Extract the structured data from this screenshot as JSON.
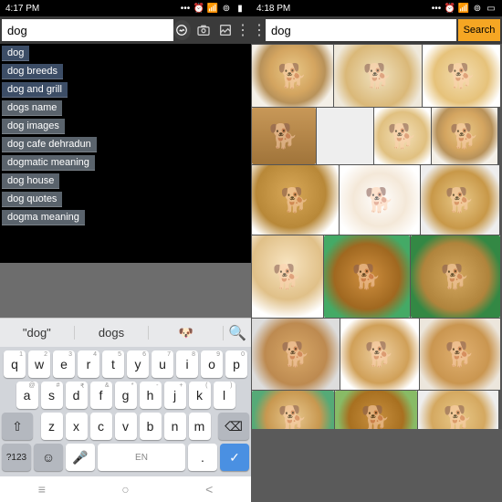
{
  "left": {
    "status": {
      "time": "4:17 PM",
      "icons": [
        "alarm",
        "wifi",
        "signal",
        "signal",
        "battery"
      ]
    },
    "search": {
      "value": "dog"
    },
    "suggestions": [
      "dog",
      "dog breeds",
      "dog and grill",
      "dogs name",
      "dog images",
      "dog cafe dehradun",
      "dogmatic meaning",
      "dog house",
      "dog quotes",
      "dogma meaning"
    ],
    "predict": [
      "\"dog\"",
      "dogs",
      "🐶"
    ],
    "keys_r1": [
      [
        "q",
        "1"
      ],
      [
        "w",
        "2"
      ],
      [
        "e",
        "3"
      ],
      [
        "r",
        "4"
      ],
      [
        "t",
        "5"
      ],
      [
        "y",
        "6"
      ],
      [
        "u",
        "7"
      ],
      [
        "i",
        "8"
      ],
      [
        "o",
        "9"
      ],
      [
        "p",
        "0"
      ]
    ],
    "keys_r2": [
      [
        "a",
        "@"
      ],
      [
        "s",
        "#"
      ],
      [
        "d",
        "₹"
      ],
      [
        "f",
        "&"
      ],
      [
        "g",
        "*"
      ],
      [
        "h",
        "-"
      ],
      [
        "j",
        "+"
      ],
      [
        "k",
        "("
      ],
      [
        "l",
        ")"
      ]
    ],
    "keys_r3": [
      "z",
      "x",
      "c",
      "v",
      "b",
      "n",
      "m"
    ],
    "numkey": "?123",
    "spacekey": "EN",
    "nav": [
      "≡",
      "○",
      "<"
    ]
  },
  "right": {
    "status": {
      "time": "4:18 PM",
      "icons": [
        "alarm",
        "wifi",
        "signal",
        "signal",
        "battery"
      ]
    },
    "search": {
      "value": "dog",
      "button": "Search"
    }
  }
}
